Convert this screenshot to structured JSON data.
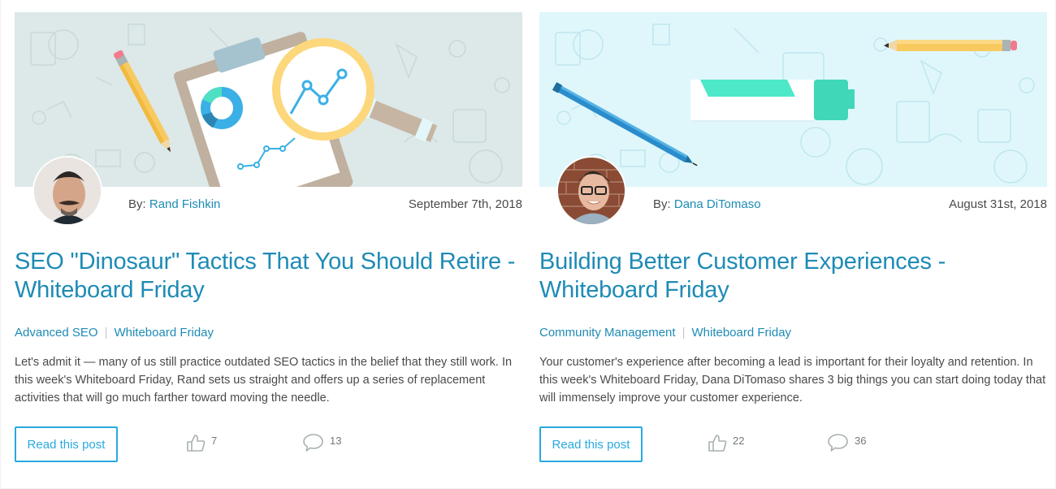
{
  "posts": [
    {
      "hero_image": "seo-analytics-illustration",
      "hero_bg": "#dde8e8",
      "avatar": "rand-fishkin-avatar",
      "by_label": "By:",
      "author": "Rand Fishkin",
      "date": "September 7th, 2018",
      "title": "SEO \"Dinosaur\" Tactics That You Should Retire - Whiteboard Friday",
      "tags": [
        "Advanced SEO",
        "Whiteboard Friday"
      ],
      "tag_separator": "|",
      "excerpt": "Let's admit it — many of us still practice outdated SEO tactics in the belief that they still work. In this week's Whiteboard Friday, Rand sets us straight and offers up a series of replacement activities that will go much farther toward moving the needle.",
      "read_label": "Read this post",
      "likes": "7",
      "likes_icon": "thumbs-up-icon",
      "comments": "13",
      "comments_icon": "speech-bubble-icon"
    },
    {
      "hero_image": "marker-pen-pencil-illustration",
      "hero_bg": "#dff7fb",
      "avatar": "dana-ditomaso-avatar",
      "by_label": "By:",
      "author": "Dana DiTomaso",
      "date": "August 31st, 2018",
      "title": "Building Better Customer Experiences - Whiteboard Friday",
      "tags": [
        "Community Management",
        "Whiteboard Friday"
      ],
      "tag_separator": "|",
      "excerpt": "Your customer's experience after becoming a lead is important for their loyalty and retention. In this week's Whiteboard Friday, Dana DiTomaso shares 3 big things you can start doing today that will immensely improve your customer experience.",
      "read_label": "Read this post",
      "likes": "22",
      "likes_icon": "thumbs-up-icon",
      "comments": "36",
      "comments_icon": "speech-bubble-icon"
    }
  ],
  "colors": {
    "link": "#1e8bb5",
    "button": "#28a9e0",
    "text": "#4a4a4a",
    "muted": "#777777"
  }
}
